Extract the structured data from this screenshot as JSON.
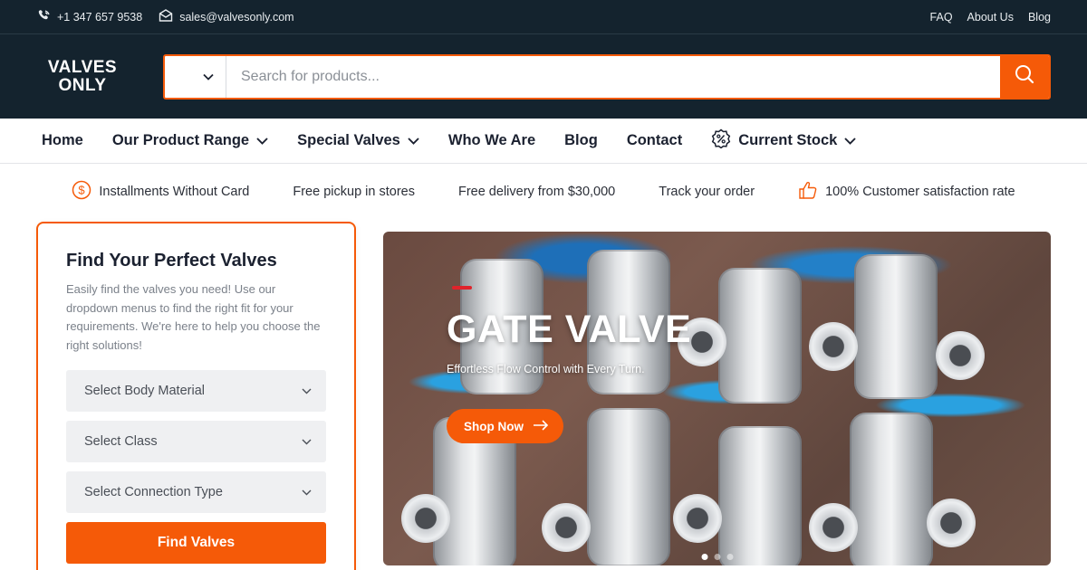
{
  "topbar": {
    "phone": "+1 347 657 9538",
    "email": "sales@valvesonly.com",
    "links": [
      "FAQ",
      "About Us",
      "Blog"
    ]
  },
  "header": {
    "logo_line1": "VALVES",
    "logo_line2": "ONLY",
    "search_placeholder": "Search for products..."
  },
  "nav": {
    "items": [
      "Home",
      "Our Product Range",
      "Special Valves",
      "Who We Are",
      "Blog",
      "Contact",
      "Current Stock"
    ]
  },
  "features": [
    "Installments Without Card",
    "Free pickup in stores",
    "Free delivery from $30,000",
    "Track your order",
    "100% Customer satisfaction rate"
  ],
  "finder": {
    "title": "Find Your Perfect Valves",
    "description": "Easily find the valves you need! Use our dropdown menus to find the right fit for your requirements. We're here to help you choose the right solutions!",
    "selects": [
      "Select Body Material",
      "Select Class",
      "Select Connection Type"
    ],
    "button": "Find Valves"
  },
  "hero": {
    "title": "GATE VALVE",
    "tagline": "Effortless Flow Control with Every Turn.",
    "button": "Shop Now",
    "slide_count": 3,
    "active_slide": 1
  },
  "colors": {
    "accent": "#f55a08",
    "dark": "#14232e",
    "hero_accent": "#e0232b"
  }
}
